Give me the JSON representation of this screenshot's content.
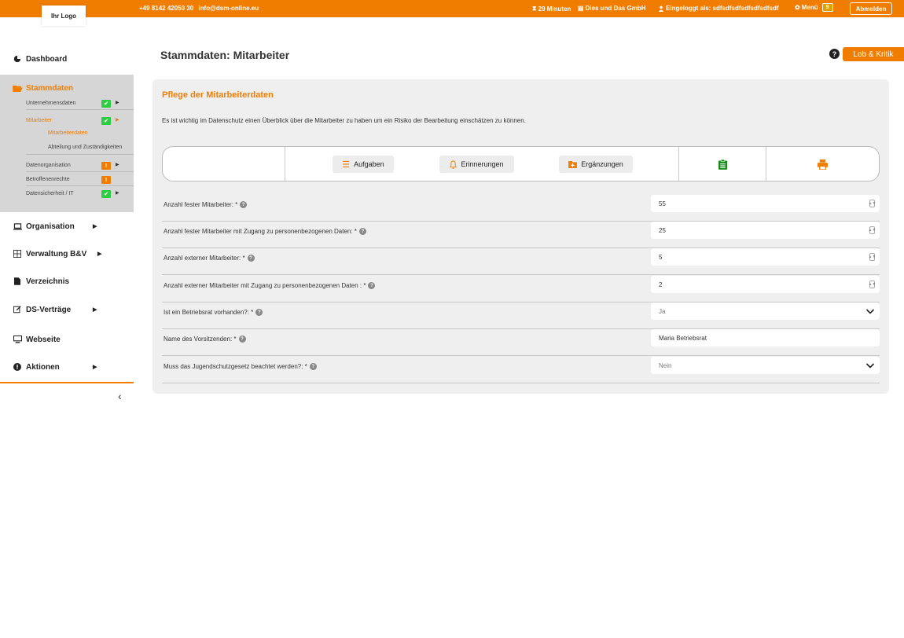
{
  "topbar": {
    "phone": "+49 8142 42050 30",
    "email": "info@dsm-online.eu",
    "timer": "29 Minuten",
    "company": "Dies und Das GmbH",
    "logged_in": "Eingeloggt als: sdfsdfsdfsdfsdfsdfsdf",
    "menu": "Menü",
    "menu_badge": "9",
    "logout": "Abmelden"
  },
  "sidebar": {
    "logo": "Ihr Logo",
    "dashboard": "Dashboard",
    "stammdaten": "Stammdaten",
    "sub": [
      {
        "label": "Unternehmensdaten",
        "status": "✔"
      },
      {
        "label": "Mitarbeiter",
        "status": "✔"
      },
      {
        "label": "Datenorganisation",
        "status": "!"
      },
      {
        "label": "Betroffenenrechte",
        "status": "!"
      },
      {
        "label": "Datensicherheit / IT",
        "status": "✔"
      }
    ],
    "mitarbeiter_sub": [
      "Mitarbeiterdaten",
      "Abteilung und Zuständigkeiten"
    ],
    "organisation": "Organisation",
    "verwaltung": "Verwaltung B&V",
    "verzeichnis": "Verzeichnis",
    "ds_vertraege": "DS-Verträge",
    "webseite": "Webseite",
    "aktionen": "Aktionen"
  },
  "header": {
    "title": "Stammdaten: Mitarbeiter",
    "help": "?",
    "feedback": "Lob & Kritik"
  },
  "panel": {
    "title": "Pflege der Mitarbeiterdaten",
    "description": "Es ist wichtig im Datenschutz einen Überblick über die Mitarbeiter zu haben um ein Risiko der Bearbeitung einschätzen zu können.",
    "toolbar": {
      "tasks": "Aufgaben",
      "reminders": "Erinnerungen",
      "additions": "Ergänzungen"
    },
    "fields": [
      {
        "label": "Anzahl fester Mitarbeiter: *",
        "value": "55"
      },
      {
        "label": "Anzahl fester Mitarbeiter mit Zugang zu personenbezogenen Daten: *",
        "value": "25"
      },
      {
        "label": "Anzahl externer Mitarbeiter: *",
        "value": "5"
      },
      {
        "label": "Anzahl externer Mitarbeiter mit Zugang zu personenbezogenen Daten : *",
        "value": "2"
      },
      {
        "label": "Ist ein Betriebsrat vorhanden?: *",
        "value": "Ja"
      },
      {
        "label": "Name des Vorsitzenden: *",
        "value": "Maria Betriebsrat"
      },
      {
        "label": "Muss das Jugendschutzgesetz beachtet werden?: *",
        "value": "Nein"
      }
    ],
    "help_icon": "?"
  },
  "colors": {
    "accent": "#f07d00",
    "ok": "#2ecc40",
    "print_icon": "#f07d00",
    "clipboard_icon": "#1a8a1a"
  }
}
